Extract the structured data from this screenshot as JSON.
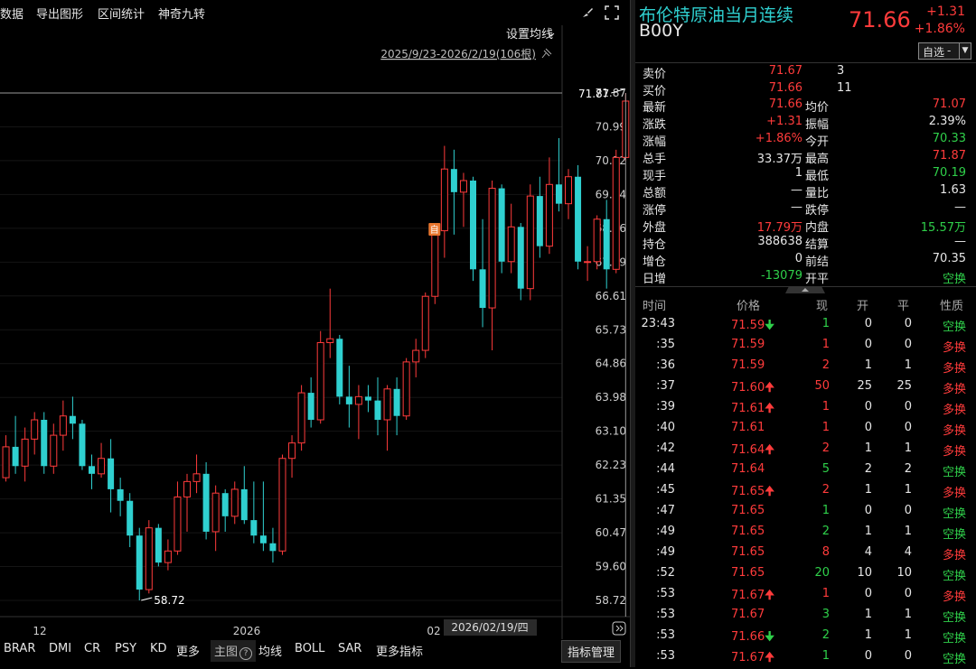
{
  "menu": {
    "items": [
      "数据",
      "导出图形",
      "区间统计",
      "神奇九转"
    ]
  },
  "chart": {
    "ma_setting_label": "设置均线",
    "range_label": "2025/9/23-2026/2/19(106根)",
    "y_ticks": [
      "71.87",
      "70.99",
      "70.12",
      "69.24",
      "68.36",
      "67.49",
      "66.61",
      "65.73",
      "64.86",
      "63.98",
      "63.10",
      "62.23",
      "61.35",
      "60.47",
      "59.60",
      "58.72"
    ],
    "x_ticks": [
      "12",
      "2026",
      "02"
    ],
    "cursor_date": "2026/02/19/四",
    "high_label": "71.87",
    "low_label": "58.72",
    "marker_label": "自",
    "up_color": "#ff3b3b",
    "down_color": "#2fd0d0"
  },
  "chart_data": {
    "type": "candlestick",
    "y_range": [
      58.72,
      71.87
    ],
    "candles": [
      [
        62.2,
        62.5,
        61.5,
        61.9
      ],
      [
        61.9,
        63.0,
        61.8,
        62.7
      ],
      [
        62.7,
        63.5,
        62.0,
        62.2
      ],
      [
        62.2,
        63.2,
        61.8,
        62.9
      ],
      [
        62.9,
        63.6,
        62.5,
        63.4
      ],
      [
        63.4,
        63.6,
        62.0,
        62.2
      ],
      [
        62.2,
        63.3,
        62.0,
        63.0
      ],
      [
        63.0,
        63.9,
        62.6,
        63.5
      ],
      [
        63.5,
        64.0,
        62.9,
        63.3
      ],
      [
        63.3,
        63.4,
        62.1,
        62.2
      ],
      [
        62.2,
        62.5,
        61.6,
        62.0
      ],
      [
        62.0,
        62.8,
        61.9,
        62.4
      ],
      [
        62.4,
        62.9,
        61.0,
        61.6
      ],
      [
        61.6,
        61.9,
        60.9,
        61.3
      ],
      [
        61.3,
        61.5,
        60.1,
        60.4
      ],
      [
        60.4,
        60.6,
        58.72,
        59.0
      ],
      [
        59.0,
        60.8,
        58.9,
        60.6
      ],
      [
        60.6,
        60.7,
        59.6,
        59.7
      ],
      [
        59.7,
        60.3,
        59.5,
        60.0
      ],
      [
        60.0,
        61.8,
        59.9,
        61.4
      ],
      [
        61.4,
        62.0,
        60.5,
        61.8
      ],
      [
        61.8,
        62.5,
        61.5,
        62.0
      ],
      [
        62.0,
        62.3,
        60.3,
        60.5
      ],
      [
        60.5,
        61.7,
        60.0,
        61.5
      ],
      [
        61.5,
        61.6,
        60.5,
        60.9
      ],
      [
        60.9,
        61.8,
        60.7,
        61.6
      ],
      [
        61.6,
        62.2,
        60.7,
        60.8
      ],
      [
        60.8,
        61.8,
        60.2,
        60.4
      ],
      [
        60.4,
        61.8,
        60.0,
        60.2
      ],
      [
        60.2,
        60.6,
        59.7,
        60.0
      ],
      [
        60.0,
        62.5,
        59.9,
        62.4
      ],
      [
        62.4,
        63.0,
        61.9,
        62.8
      ],
      [
        62.8,
        64.3,
        62.6,
        64.1
      ],
      [
        64.1,
        64.5,
        63.2,
        63.4
      ],
      [
        63.4,
        65.7,
        63.3,
        65.4
      ],
      [
        65.4,
        66.8,
        65.0,
        65.5
      ],
      [
        65.5,
        65.6,
        63.8,
        64.0
      ],
      [
        64.0,
        64.8,
        63.2,
        63.8
      ],
      [
        63.8,
        64.3,
        62.9,
        64.0
      ],
      [
        64.0,
        64.3,
        63.6,
        63.9
      ],
      [
        63.9,
        64.5,
        63.0,
        63.4
      ],
      [
        63.4,
        64.3,
        62.6,
        64.2
      ],
      [
        64.2,
        64.5,
        63.0,
        63.5
      ],
      [
        63.5,
        65.0,
        63.4,
        64.9
      ],
      [
        64.9,
        65.5,
        64.5,
        65.2
      ],
      [
        65.2,
        66.7,
        65.0,
        66.6
      ],
      [
        66.6,
        68.5,
        66.4,
        68.3
      ],
      [
        68.3,
        70.5,
        67.6,
        69.9
      ],
      [
        69.9,
        70.4,
        68.2,
        69.3
      ],
      [
        69.3,
        69.8,
        68.4,
        69.6
      ],
      [
        69.6,
        69.7,
        67.0,
        67.3
      ],
      [
        67.3,
        68.6,
        65.8,
        66.3
      ],
      [
        66.3,
        69.6,
        65.2,
        69.4
      ],
      [
        69.4,
        69.5,
        67.2,
        67.5
      ],
      [
        67.5,
        69.0,
        67.2,
        68.4
      ],
      [
        68.4,
        68.5,
        66.5,
        66.8
      ],
      [
        66.8,
        69.5,
        66.5,
        69.2
      ],
      [
        69.2,
        69.7,
        67.6,
        67.9
      ],
      [
        67.9,
        70.2,
        67.7,
        69.5
      ],
      [
        69.5,
        70.7,
        68.8,
        69.0
      ],
      [
        69.0,
        69.9,
        68.6,
        69.7
      ],
      [
        69.7,
        70.0,
        67.3,
        67.5
      ],
      [
        67.5,
        67.9,
        67.0,
        67.5
      ],
      [
        67.5,
        68.7,
        67.3,
        68.6
      ],
      [
        68.6,
        69.1,
        66.8,
        67.3
      ],
      [
        67.3,
        70.4,
        67.2,
        70.2
      ],
      [
        70.2,
        71.87,
        70.1,
        71.66
      ]
    ]
  },
  "quote": {
    "name": "布伦特原油当月连续",
    "code": "B00Y",
    "price": "71.66",
    "change": "+1.31",
    "change_pct": "+1.86%",
    "zixuan": "自选",
    "ask_label": "卖价",
    "ask_price": "71.67",
    "ask_vol": "3",
    "bid_label": "买价",
    "bid_price": "71.66",
    "bid_vol": "11",
    "stats": [
      {
        "l1": "最新",
        "v1": "71.66",
        "c1": "red",
        "l2": "均价",
        "v2": "71.07",
        "c2": "red"
      },
      {
        "l1": "涨跌",
        "v1": "+1.31",
        "c1": "red",
        "l2": "振幅",
        "v2": "2.39%",
        "c2": "white"
      },
      {
        "l1": "涨幅",
        "v1": "+1.86%",
        "c1": "red",
        "l2": "今开",
        "v2": "70.33",
        "c2": "green"
      },
      {
        "l1": "总手",
        "v1": "33.37万",
        "c1": "white",
        "l2": "最高",
        "v2": "71.87",
        "c2": "red"
      },
      {
        "l1": "现手",
        "v1": "1",
        "c1": "white",
        "l2": "最低",
        "v2": "70.19",
        "c2": "green"
      },
      {
        "l1": "总额",
        "v1": "—",
        "c1": "white",
        "l2": "量比",
        "v2": "1.63",
        "c2": "white"
      },
      {
        "l1": "涨停",
        "v1": "—",
        "c1": "white",
        "l2": "跌停",
        "v2": "—",
        "c2": "white"
      },
      {
        "l1": "外盘",
        "v1": "17.79万",
        "c1": "red",
        "l2": "内盘",
        "v2": "15.57万",
        "c2": "green"
      },
      {
        "l1": "持仓",
        "v1": "388638",
        "c1": "white",
        "l2": "结算",
        "v2": "—",
        "c2": "white"
      },
      {
        "l1": "增仓",
        "v1": "0",
        "c1": "white",
        "l2": "前结",
        "v2": "70.35",
        "c2": "white"
      },
      {
        "l1": "日增",
        "v1": "-13079",
        "c1": "green",
        "l2": "开平",
        "v2": "空换",
        "c2": "green"
      }
    ],
    "tick_headers": [
      "时间",
      "价格",
      "现",
      "开",
      "平",
      "性质"
    ],
    "ticks": [
      {
        "t": "23:43",
        "p": "71.59",
        "arrow": "down",
        "v": "1",
        "vc": "green",
        "o": "0",
        "c": "0",
        "n": "空换",
        "nc": "green"
      },
      {
        "t": ":35",
        "p": "71.59",
        "arrow": "",
        "v": "1",
        "vc": "red",
        "o": "0",
        "c": "0",
        "n": "多换",
        "nc": "red"
      },
      {
        "t": ":36",
        "p": "71.59",
        "arrow": "",
        "v": "2",
        "vc": "red",
        "o": "1",
        "c": "1",
        "n": "多换",
        "nc": "red"
      },
      {
        "t": ":37",
        "p": "71.60",
        "arrow": "up",
        "v": "50",
        "vc": "red",
        "o": "25",
        "c": "25",
        "n": "多换",
        "nc": "red"
      },
      {
        "t": ":39",
        "p": "71.61",
        "arrow": "up",
        "v": "1",
        "vc": "red",
        "o": "0",
        "c": "0",
        "n": "多换",
        "nc": "red"
      },
      {
        "t": ":40",
        "p": "71.61",
        "arrow": "",
        "v": "1",
        "vc": "red",
        "o": "0",
        "c": "0",
        "n": "多换",
        "nc": "red"
      },
      {
        "t": ":42",
        "p": "71.64",
        "arrow": "up",
        "v": "2",
        "vc": "red",
        "o": "1",
        "c": "1",
        "n": "多换",
        "nc": "red"
      },
      {
        "t": ":44",
        "p": "71.64",
        "arrow": "",
        "v": "5",
        "vc": "green",
        "o": "2",
        "c": "2",
        "n": "空换",
        "nc": "green"
      },
      {
        "t": ":45",
        "p": "71.65",
        "arrow": "up",
        "v": "2",
        "vc": "red",
        "o": "1",
        "c": "1",
        "n": "多换",
        "nc": "red"
      },
      {
        "t": ":47",
        "p": "71.65",
        "arrow": "",
        "v": "1",
        "vc": "green",
        "o": "0",
        "c": "0",
        "n": "空换",
        "nc": "green"
      },
      {
        "t": ":49",
        "p": "71.65",
        "arrow": "",
        "v": "2",
        "vc": "green",
        "o": "1",
        "c": "1",
        "n": "空换",
        "nc": "green"
      },
      {
        "t": ":49",
        "p": "71.65",
        "arrow": "",
        "v": "8",
        "vc": "red",
        "o": "4",
        "c": "4",
        "n": "多换",
        "nc": "red"
      },
      {
        "t": ":52",
        "p": "71.65",
        "arrow": "",
        "v": "20",
        "vc": "green",
        "o": "10",
        "c": "10",
        "n": "空换",
        "nc": "green"
      },
      {
        "t": ":53",
        "p": "71.67",
        "arrow": "up",
        "v": "1",
        "vc": "red",
        "o": "0",
        "c": "0",
        "n": "多换",
        "nc": "red"
      },
      {
        "t": ":53",
        "p": "71.67",
        "arrow": "",
        "v": "3",
        "vc": "green",
        "o": "1",
        "c": "1",
        "n": "空换",
        "nc": "green"
      },
      {
        "t": ":53",
        "p": "71.66",
        "arrow": "down",
        "v": "2",
        "vc": "green",
        "o": "1",
        "c": "1",
        "n": "空换",
        "nc": "green"
      },
      {
        "t": ":53",
        "p": "71.67",
        "arrow": "up",
        "v": "1",
        "vc": "green",
        "o": "0",
        "c": "0",
        "n": "空换",
        "nc": "green"
      }
    ]
  },
  "bottom": {
    "tabs": [
      "BRAR",
      "DMI",
      "CR",
      "PSY",
      "KD",
      "更多"
    ],
    "main_label": "主图",
    "indicators": [
      "均线",
      "BOLL",
      "SAR",
      "更多指标"
    ],
    "manage_label": "指标管理"
  }
}
